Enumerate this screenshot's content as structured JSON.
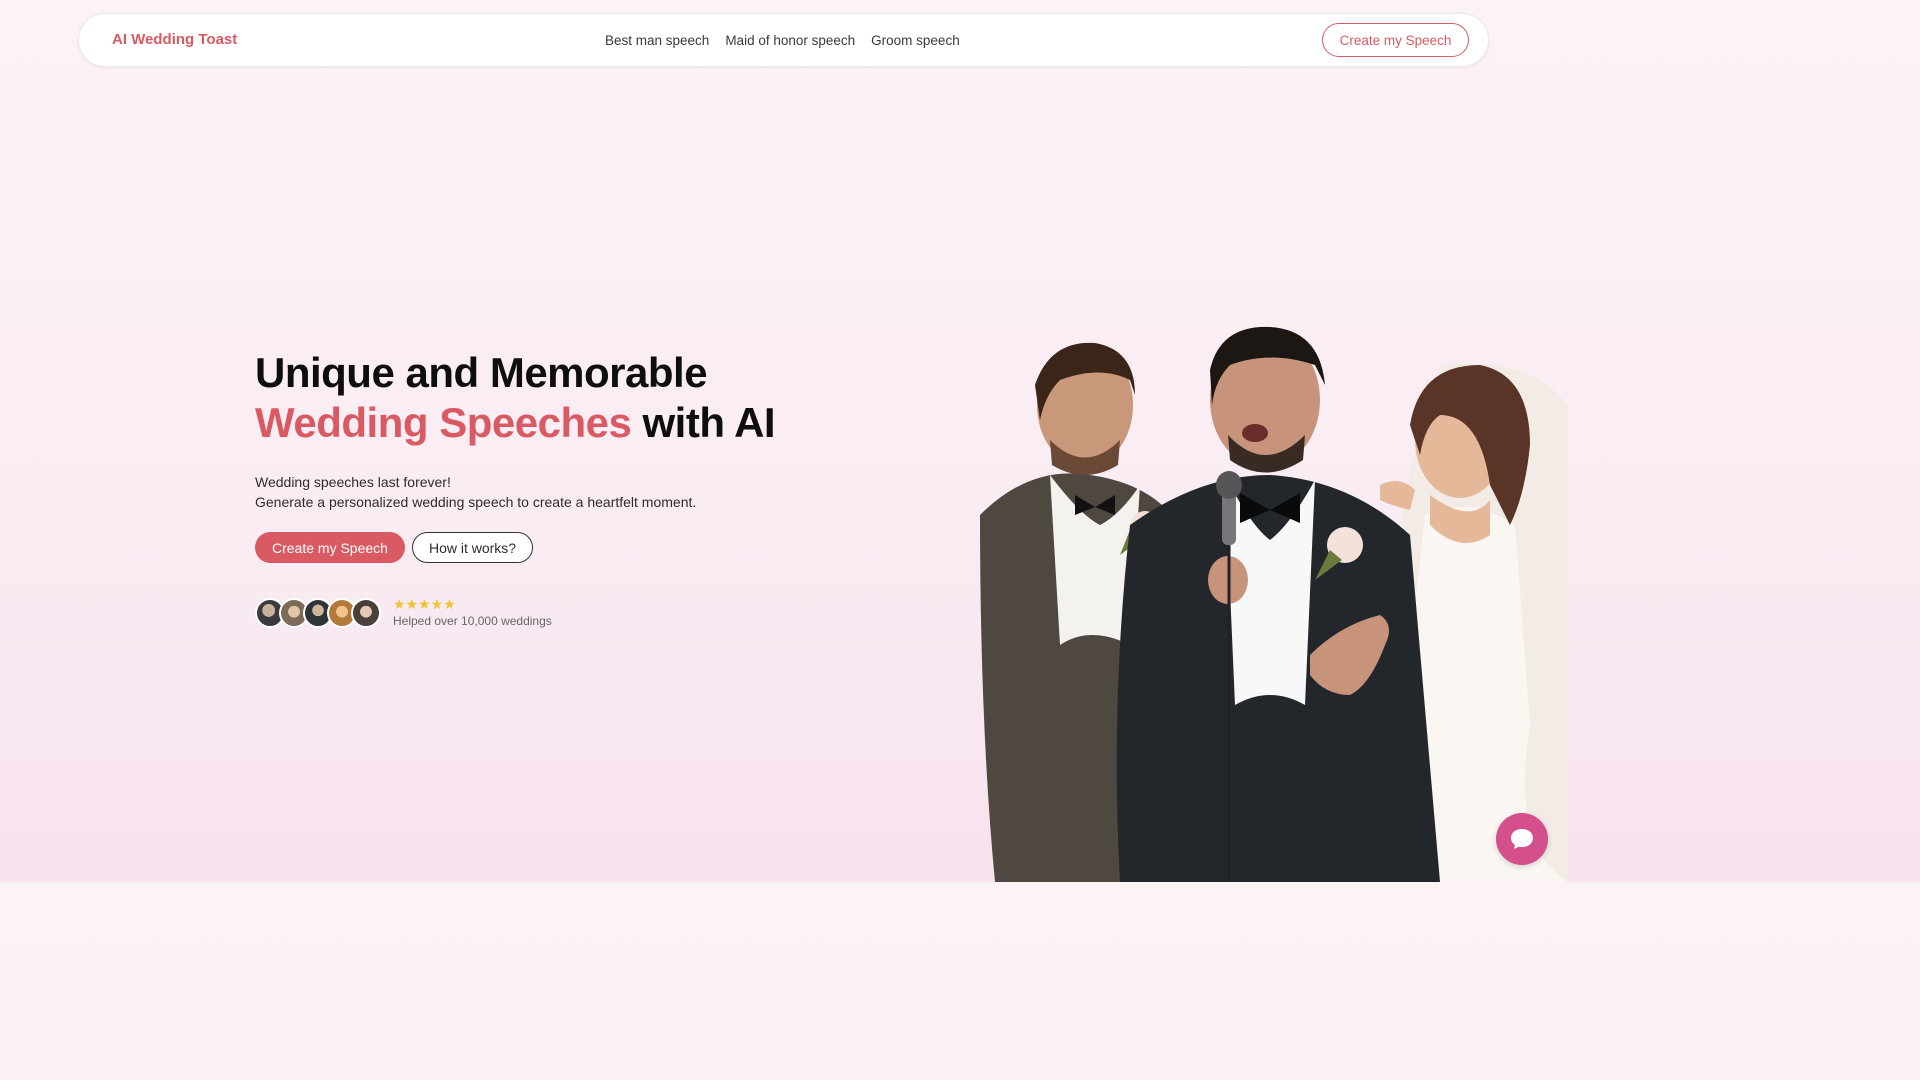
{
  "nav": {
    "brand": "AI Wedding Toast",
    "links": [
      "Best man speech",
      "Maid of honor speech",
      "Groom speech"
    ],
    "cta_label": "Create my Speech"
  },
  "hero": {
    "headline_line1": "Unique and Memorable",
    "headline_accent": "Wedding Speeches",
    "headline_rest": " with AI",
    "sub_line1": "Wedding speeches last forever!",
    "sub_line2": "Generate a personalized wedding speech to create a heartfelt moment.",
    "primary_label": "Create my Speech",
    "secondary_label": "How it works?",
    "stars": "★★★★★",
    "proof_text": "Helped over 10,000 weddings"
  },
  "colors": {
    "accent": "#d95a62",
    "star": "#f2c230",
    "chat": "#d3508d"
  },
  "icons": {
    "chat": "chat-bubble-icon",
    "rating": "star-icon"
  }
}
